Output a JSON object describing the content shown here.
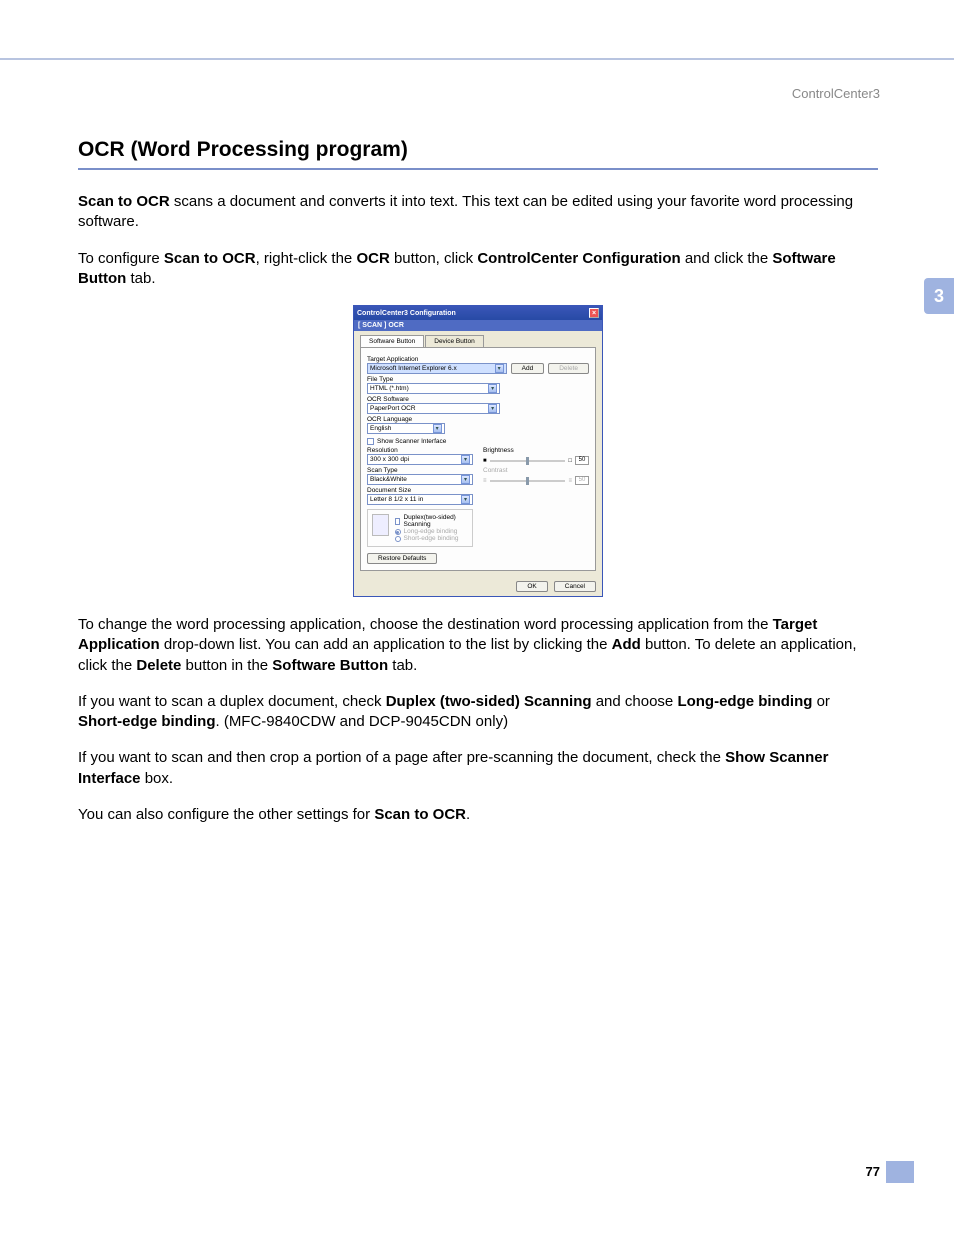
{
  "header": {
    "product": "ControlCenter3"
  },
  "side_tab": "3",
  "page_number": "77",
  "section": {
    "title": "OCR (Word Processing program)",
    "intro_1a": "Scan to OCR",
    "intro_1b": " scans a document and converts it into text. This text can be edited using your favorite word processing software.",
    "intro_2a": "To configure ",
    "intro_2b": "Scan to OCR",
    "intro_2c": ", right-click the ",
    "intro_2d": "OCR",
    "intro_2e": " button, click ",
    "intro_2f": "ControlCenter Configuration",
    "intro_2g": " and click the ",
    "intro_2h": "Software Button",
    "intro_2i": " tab.",
    "p3a": "To change the word processing application, choose the destination word processing application from the ",
    "p3b": "Target Application",
    "p3c": " drop-down list. You can add an application to the list by clicking the ",
    "p3d": "Add",
    "p3e": " button. To delete an application, click the ",
    "p3f": "Delete",
    "p3g": " button in the ",
    "p3h": "Software Button",
    "p3i": " tab.",
    "p4a": "If you want to scan a duplex document, check ",
    "p4b": "Duplex (two-sided) Scanning",
    "p4c": " and choose ",
    "p4d": "Long-edge binding",
    "p4e": " or ",
    "p4f": "Short-edge binding",
    "p4g": ". (MFC-9840CDW and DCP-9045CDN only)",
    "p5a": "If you want to scan and then crop a portion of a page after pre-scanning the document, check the ",
    "p5b": "Show Scanner Interface",
    "p5c": " box.",
    "p6a": "You can also configure the other settings for ",
    "p6b": "Scan to OCR",
    "p6c": "."
  },
  "dialog": {
    "title": "ControlCenter3 Configuration",
    "subtitle": "[ SCAN ]  OCR",
    "tabs": {
      "software": "Software Button",
      "device": "Device Button"
    },
    "labels": {
      "target_app": "Target Application",
      "file_type": "File Type",
      "ocr_software": "OCR Software",
      "ocr_language": "OCR Language",
      "show_scanner": "Show Scanner Interface",
      "resolution": "Resolution",
      "scan_type": "Scan Type",
      "document_size": "Document Size",
      "brightness": "Brightness",
      "contrast": "Contrast",
      "duplex": "Duplex(two-sided) Scanning",
      "long_edge": "Long-edge binding",
      "short_edge": "Short-edge binding"
    },
    "values": {
      "target_app": "Microsoft Internet Explorer 6.x",
      "file_type": "HTML (*.htm)",
      "ocr_software": "PaperPort OCR",
      "ocr_language": "English",
      "resolution": "300 x 300 dpi",
      "scan_type": "Black&White",
      "document_size": "Letter 8 1/2 x 11 in",
      "brightness": "50",
      "contrast": "50"
    },
    "buttons": {
      "add": "Add",
      "delete": "Delete",
      "restore": "Restore Defaults",
      "ok": "OK",
      "cancel": "Cancel"
    }
  }
}
